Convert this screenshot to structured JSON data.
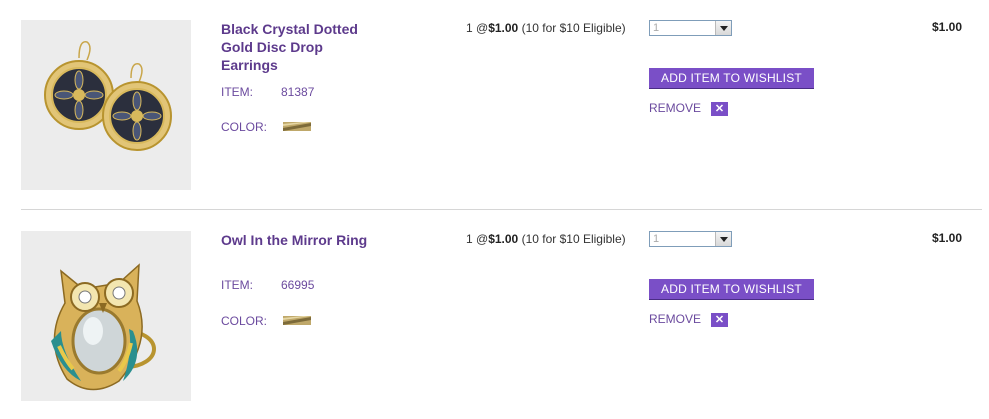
{
  "items": [
    {
      "name": "Black Crystal Dotted Gold Disc Drop Earrings",
      "item_label": "ITEM:",
      "item_number": "81387",
      "color_label": "COLOR:",
      "price_qty": "1 @",
      "price": "$1.00",
      "price_note": "(10 for $10 Eligible)",
      "quantity": "1",
      "wishlist_label": "ADD ITEM TO WISHLIST",
      "remove_label": "REMOVE",
      "remove_icon": "✕",
      "total": "$1.00",
      "image": "earrings"
    },
    {
      "name": "Owl In the Mirror Ring",
      "item_label": "ITEM:",
      "item_number": "66995",
      "color_label": "COLOR:",
      "price_qty": "1 @",
      "price": "$1.00",
      "price_note": "(10 for $10 Eligible)",
      "quantity": "1",
      "wishlist_label": "ADD ITEM TO WISHLIST",
      "remove_label": "REMOVE",
      "remove_icon": "✕",
      "total": "$1.00",
      "image": "owl-ring"
    }
  ],
  "colors": {
    "accent": "#7a4fc7",
    "name_text": "#5d3a8c",
    "label_text": "#6b4a9e"
  }
}
